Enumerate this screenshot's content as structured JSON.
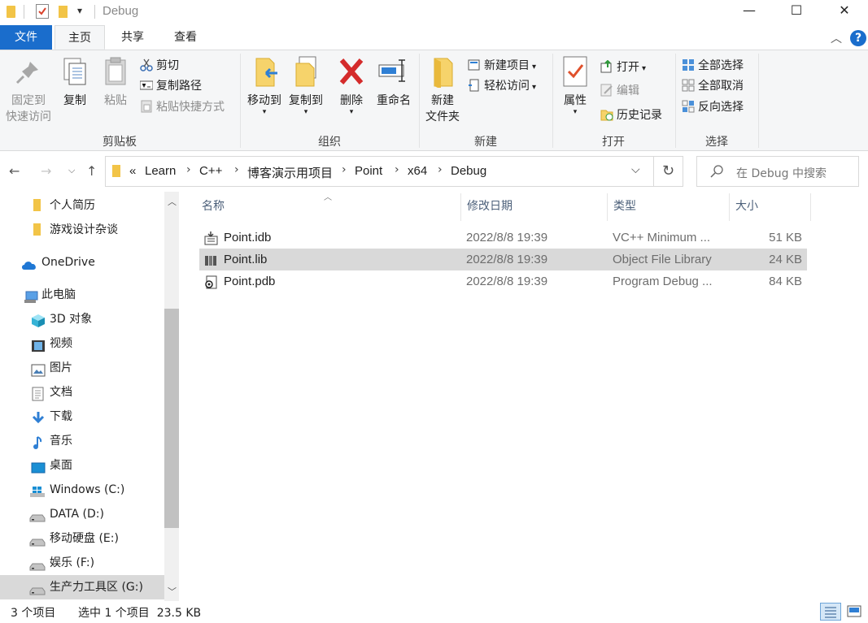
{
  "window": {
    "title": "Debug",
    "controls": {
      "minimize": "—",
      "maximize": "☐",
      "close": "✕"
    }
  },
  "ribbon": {
    "tabs": [
      {
        "label": "文件"
      },
      {
        "label": "主页"
      },
      {
        "label": "共享"
      },
      {
        "label": "查看"
      }
    ],
    "clipboard": {
      "group_label": "剪贴板",
      "pin_line1": "固定到",
      "pin_line2": "快速访问",
      "copy": "复制",
      "paste": "粘贴",
      "cut": "剪切",
      "copy_path": "复制路径",
      "paste_shortcut": "粘贴快捷方式"
    },
    "organize": {
      "group_label": "组织",
      "move_to": "移动到",
      "copy_to": "复制到",
      "delete": "删除",
      "rename": "重命名"
    },
    "new": {
      "group_label": "新建",
      "new_folder_line1": "新建",
      "new_folder_line2": "文件夹",
      "new_item": "新建项目",
      "easy_access": "轻松访问"
    },
    "open": {
      "group_label": "打开",
      "properties": "属性",
      "open": "打开",
      "edit": "编辑",
      "history": "历史记录"
    },
    "select": {
      "group_label": "选择",
      "select_all": "全部选择",
      "select_none": "全部取消",
      "invert": "反向选择"
    }
  },
  "address": {
    "overflow": "«",
    "crumbs": [
      "Learn",
      "C++",
      "博客演示用项目",
      "Point",
      "x64",
      "Debug"
    ]
  },
  "search": {
    "placeholder": "在 Debug 中搜索"
  },
  "nav_pane": {
    "items": [
      {
        "label": "个人简历",
        "icon": "folder-icon"
      },
      {
        "label": "游戏设计杂谈",
        "icon": "folder-icon"
      },
      {
        "label": "OneDrive",
        "icon": "cloud-icon"
      },
      {
        "label": "此电脑",
        "icon": "computer-icon"
      },
      {
        "label": "3D 对象",
        "icon": "cube-icon"
      },
      {
        "label": "视频",
        "icon": "video-icon"
      },
      {
        "label": "图片",
        "icon": "picture-icon"
      },
      {
        "label": "文档",
        "icon": "document-icon"
      },
      {
        "label": "下载",
        "icon": "download-icon"
      },
      {
        "label": "音乐",
        "icon": "music-icon"
      },
      {
        "label": "桌面",
        "icon": "desktop-icon"
      },
      {
        "label": "Windows (C:)",
        "icon": "windows-drive-icon"
      },
      {
        "label": "DATA (D:)",
        "icon": "drive-icon"
      },
      {
        "label": "移动硬盘 (E:)",
        "icon": "drive-icon"
      },
      {
        "label": "娱乐 (F:)",
        "icon": "drive-icon"
      },
      {
        "label": "生产力工具区 (G:)",
        "icon": "drive-icon"
      }
    ]
  },
  "file_list": {
    "columns": {
      "name": "名称",
      "date": "修改日期",
      "type": "类型",
      "size": "大小"
    },
    "rows": [
      {
        "name": "Point.idb",
        "date": "2022/8/8 19:39",
        "type": "VC++ Minimum ...",
        "size": "51 KB",
        "icon": "idb-file-icon"
      },
      {
        "name": "Point.lib",
        "date": "2022/8/8 19:39",
        "type": "Object File Library",
        "size": "24 KB",
        "icon": "lib-file-icon"
      },
      {
        "name": "Point.pdb",
        "date": "2022/8/8 19:39",
        "type": "Program Debug ...",
        "size": "84 KB",
        "icon": "pdb-file-icon"
      }
    ]
  },
  "status": {
    "count": "3 个项目",
    "selection": "选中 1 个项目  23.5 KB"
  },
  "colors": {
    "accent": "#1a6dcc",
    "selection": "#d9d9d9",
    "header_text": "#4c607a"
  }
}
